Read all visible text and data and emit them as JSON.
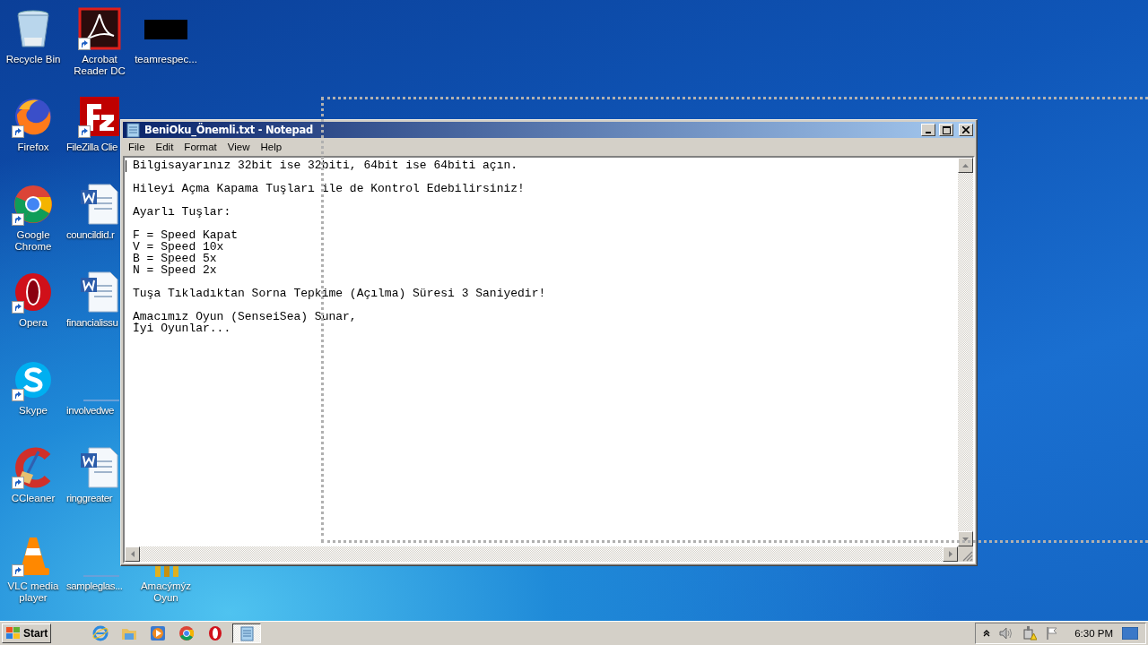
{
  "desktop_icons": [
    {
      "label": "Recycle Bin",
      "kind": "recycle",
      "shortcut": false
    },
    {
      "label": "Acrobat Reader DC",
      "kind": "acrobat",
      "shortcut": true
    },
    {
      "label": "teamrespec...",
      "kind": "redacted",
      "shortcut": false
    },
    {
      "label": "Firefox",
      "kind": "firefox",
      "shortcut": true
    },
    {
      "label": "FileZilla Clie",
      "kind": "filezilla",
      "shortcut": true
    },
    {
      "label": "Google Chrome",
      "kind": "chrome",
      "shortcut": true
    },
    {
      "label": "councildid.r",
      "kind": "word",
      "shortcut": false
    },
    {
      "label": "Opera",
      "kind": "opera",
      "shortcut": true
    },
    {
      "label": "financialissu",
      "kind": "word",
      "shortcut": false
    },
    {
      "label": "Skype",
      "kind": "skype",
      "shortcut": true
    },
    {
      "label": "involvedwe",
      "kind": "blank",
      "shortcut": false
    },
    {
      "label": "CCleaner",
      "kind": "ccleaner",
      "shortcut": true
    },
    {
      "label": "ringgreater",
      "kind": "word",
      "shortcut": false
    },
    {
      "label": "VLC media player",
      "kind": "vlc",
      "shortcut": true
    },
    {
      "label": "sampleglas...",
      "kind": "blank",
      "shortcut": false
    },
    {
      "label": "Amacýmýz Oyun",
      "kind": "game",
      "shortcut": false
    }
  ],
  "window": {
    "title": "BeniOku_Önemli.txt - Notepad",
    "menu": [
      "File",
      "Edit",
      "Format",
      "View",
      "Help"
    ],
    "paragraphs": [
      [
        "Bilgisayarınız 32bit ise 32biti, 64bit ise 64biti açın."
      ],
      [
        "Hileyi Açma Kapama Tuşları ile de Kontrol Edebilirsiniz!"
      ],
      [
        "Ayarlı Tuşlar:"
      ],
      [
        "F = Speed Kapat",
        "V = Speed 10x",
        "B = Speed 5x",
        "N = Speed 2x"
      ],
      [
        "Tuşa Tıkladıktan Sorna Tepkime (Açılma) Süresi 3 Saniyedir!"
      ],
      [
        "Amacımız Oyun (SenseiSea) Sunar,",
        "İyi Oyunlar..."
      ]
    ]
  },
  "taskbar": {
    "start": "Start",
    "apps": [
      {
        "kind": "ie",
        "selected": false
      },
      {
        "kind": "explorer",
        "selected": false
      },
      {
        "kind": "media",
        "selected": false
      },
      {
        "kind": "chrome",
        "selected": false
      },
      {
        "kind": "opera",
        "selected": false
      },
      {
        "kind": "notepad",
        "selected": true
      }
    ],
    "clock": "6:30 PM"
  }
}
